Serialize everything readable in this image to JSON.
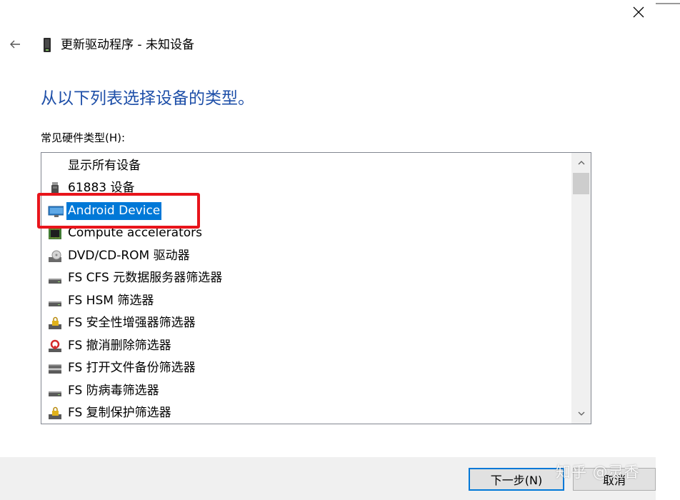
{
  "window": {
    "title": "更新驱动程序 - 未知设备"
  },
  "heading": "从以下列表选择设备的类型。",
  "list_label": "常见硬件类型(H):",
  "hardware_types": [
    {
      "label": "显示所有设备",
      "icon": "none"
    },
    {
      "label": "61883 设备",
      "icon": "usb-device-icon"
    },
    {
      "label": "Android Device",
      "icon": "monitor-icon",
      "selected": true
    },
    {
      "label": "Compute accelerators",
      "icon": "chip-icon"
    },
    {
      "label": "DVD/CD-ROM 驱动器",
      "icon": "dvd-drive-icon"
    },
    {
      "label": "FS CFS 元数据服务器筛选器",
      "icon": "drive-icon"
    },
    {
      "label": "FS HSM 筛选器",
      "icon": "drive-icon"
    },
    {
      "label": "FS 安全性增强器筛选器",
      "icon": "drive-lock-icon"
    },
    {
      "label": "FS 撤消删除筛选器",
      "icon": "drive-undelete-icon"
    },
    {
      "label": "FS 打开文件备份筛选器",
      "icon": "drive-stack-icon"
    },
    {
      "label": "FS 防病毒筛选器",
      "icon": "drive-icon"
    },
    {
      "label": "FS 复制保护筛选器",
      "icon": "drive-lock-icon"
    }
  ],
  "buttons": {
    "next": "下一步(N)",
    "cancel": "取消"
  },
  "watermark": "知乎 @灵香",
  "colors": {
    "heading": "#1e4fa8",
    "selection": "#0078d7",
    "annotation_box": "#e8141b"
  }
}
